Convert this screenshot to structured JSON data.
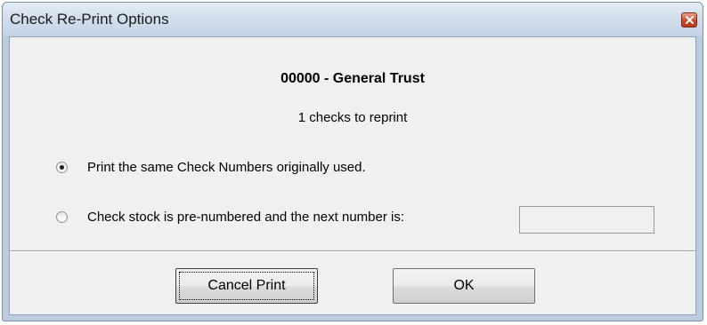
{
  "window": {
    "title": "Check Re-Print Options"
  },
  "content": {
    "heading": "00000 - General Trust",
    "subheading": "1 checks to reprint"
  },
  "options": {
    "same_numbers_label": "Print the same Check Numbers originally used.",
    "same_numbers_selected": true,
    "prenumbered_label": "Check stock is pre-numbered and the next number is:",
    "prenumbered_selected": false,
    "next_number_value": ""
  },
  "buttons": {
    "cancel_label": "Cancel Print",
    "ok_label": "OK"
  },
  "icons": {
    "close": "close-icon"
  }
}
